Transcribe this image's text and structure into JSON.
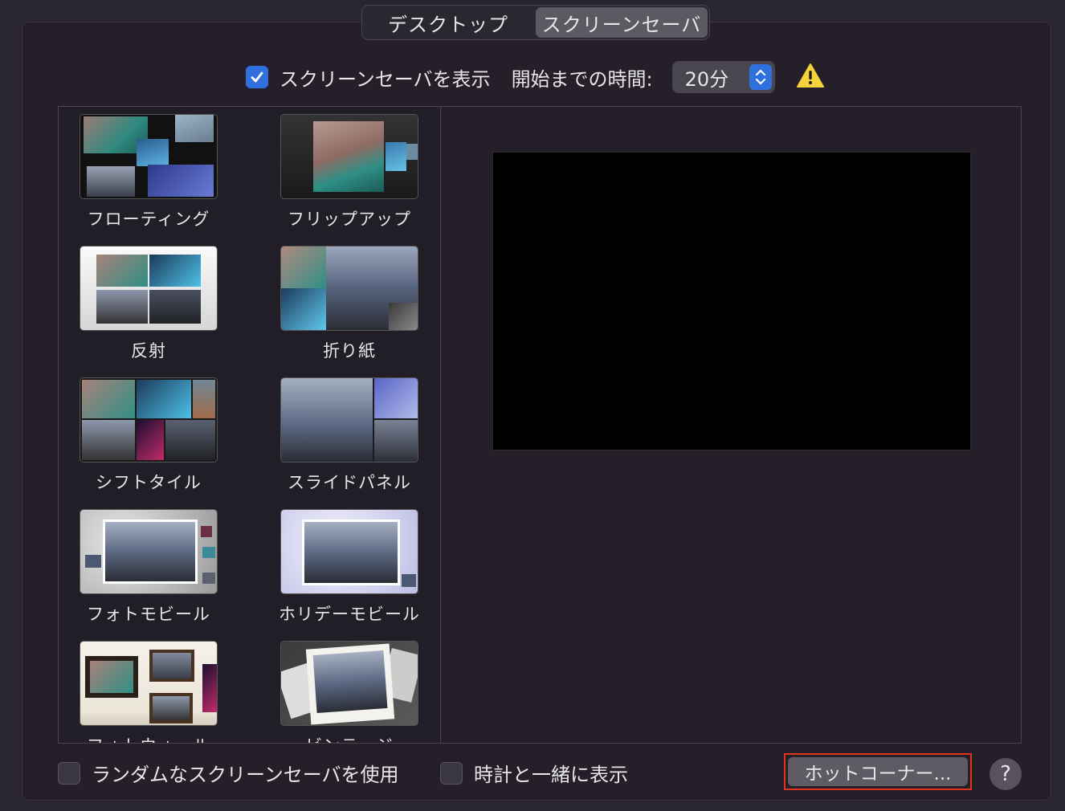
{
  "tabs": [
    {
      "label": "デスクトップ",
      "active": false
    },
    {
      "label": "スクリーンセーバ",
      "active": true
    }
  ],
  "show_screensaver": {
    "label": "スクリーンセーバを表示",
    "checked": true
  },
  "start_after": {
    "label": "開始までの時間:",
    "value": "20分"
  },
  "warning_icon": "warning-triangle-icon",
  "screensavers": [
    {
      "label": "フローティング"
    },
    {
      "label": "フリップアップ"
    },
    {
      "label": "反射"
    },
    {
      "label": "折り紙"
    },
    {
      "label": "シフトタイル"
    },
    {
      "label": "スライドパネル"
    },
    {
      "label": "フォトモビール"
    },
    {
      "label": "ホリデーモビール"
    },
    {
      "label": "フォトウォール"
    },
    {
      "label": "ビンテージ"
    }
  ],
  "random_screensaver": {
    "label": "ランダムなスクリーンセーバを使用",
    "checked": false
  },
  "show_with_clock": {
    "label": "時計と一緒に表示",
    "checked": false
  },
  "hot_corners_button": "ホットコーナー...",
  "help_button": "?",
  "colors": {
    "accent": "#2f6fde",
    "highlight": "#e0341e",
    "warning": "#f5d33a"
  }
}
